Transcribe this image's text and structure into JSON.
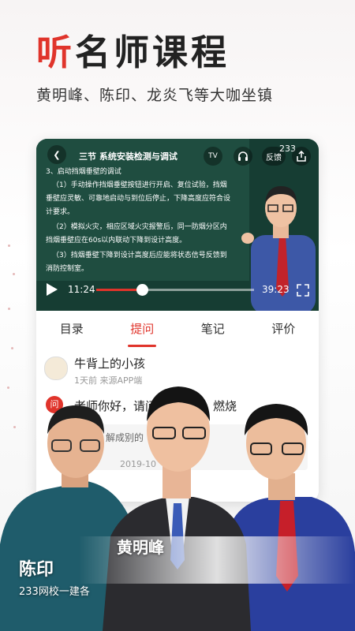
{
  "promo": {
    "headline_accent": "听",
    "headline_rest": "名师课程",
    "subheadline": "黄明峰、陈印、龙炎飞等大咖坐镇"
  },
  "video": {
    "board_title": "三节  系统安装检测与调试",
    "board_lines": [
      "3、启动挡烟垂壁的调试",
      "（1）手动操作挡烟垂壁按钮进行开启、复位试验，挡烟",
      "垂壁应灵敏、可靠地启动与到位后停止，下降高度应符合设",
      "计要求。",
      "（2）模拟火灾，相应区域火灾报警后，同一防烟分区内",
      "挡烟垂壁应在60s以内联动下降到设计高度。",
      "（3）挡烟垂壁下降到设计高度后应能将状态信号反馈到",
      "消防控制室。"
    ],
    "controls": {
      "back_icon": "chevron-left-icon",
      "tv_label": "TV",
      "audio_icon": "headphones-icon",
      "feedback_label": "反馈",
      "share_icon": "share-icon",
      "top_right_partial": "233",
      "play_icon": "play-icon",
      "fullscreen_icon": "fullscreen-icon"
    },
    "current_time": "11:24",
    "duration": "39:23",
    "progress": 0.29
  },
  "tabs": [
    {
      "label": "目录",
      "active": false
    },
    {
      "label": "提问",
      "active": true
    },
    {
      "label": "笔记",
      "active": false
    },
    {
      "label": "评价",
      "active": false
    }
  ],
  "qa": {
    "username": "牛背上的小孩",
    "meta": "1天前  来源APP端",
    "question_badge": "问",
    "question_text_start": "老师你好，请问",
    "question_text_end": "燃烧",
    "answer_text": "解成别的",
    "answer_date": "2019-10"
  },
  "teachers": {
    "left_name": "陈印",
    "left_subtitle": "233网校一建各",
    "center_name": "黄明峰"
  },
  "colors": {
    "accent": "#e0342b",
    "board_green": "#1f4d40"
  }
}
